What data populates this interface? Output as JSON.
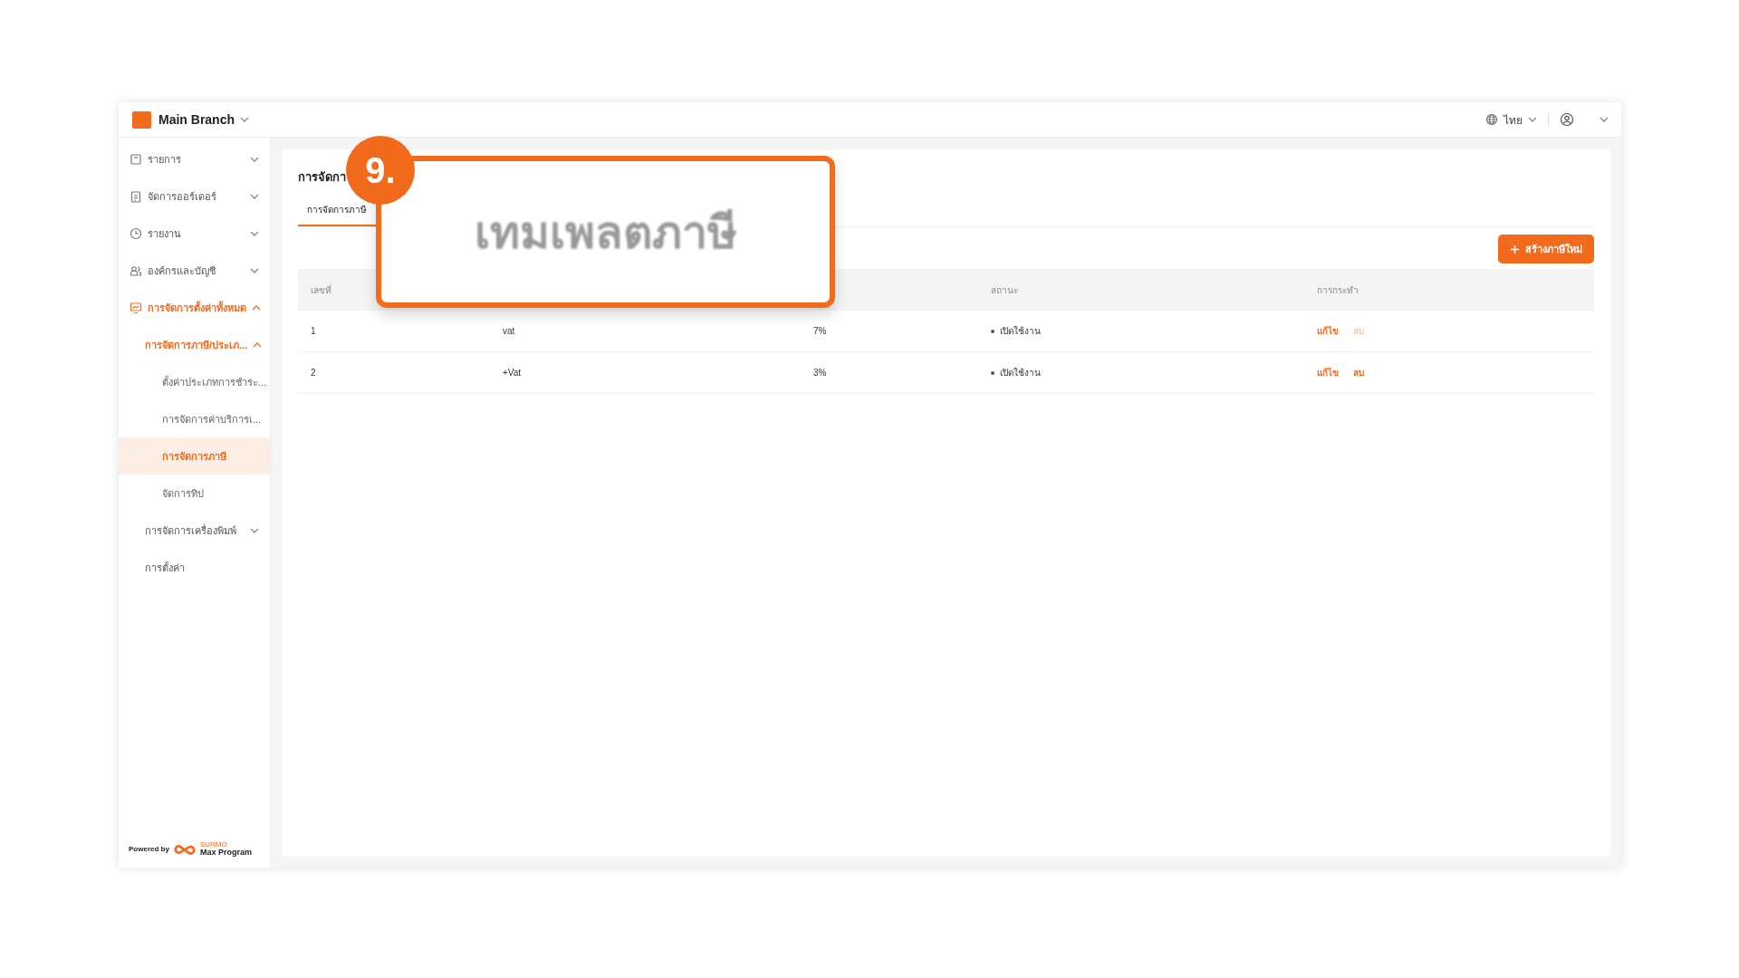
{
  "topbar": {
    "branch": "Main Branch",
    "language": "ไทย"
  },
  "sidebar": {
    "items": [
      {
        "label": "รายการ",
        "expanded": false,
        "selected": false
      },
      {
        "label": "จัดการออร์เดอร์",
        "expanded": false,
        "selected": false
      },
      {
        "label": "รายงาน",
        "expanded": false,
        "selected": false
      },
      {
        "label": "องค์กรและบัญชี",
        "expanded": false,
        "selected": false
      },
      {
        "label": "การจัดการตั้งค่าทั้งหมด",
        "expanded": true,
        "selected": true,
        "children": [
          {
            "label": "การจัดการภาษี/ประเภ...",
            "expanded": true,
            "selected": true,
            "children": [
              {
                "label": "ตั้งค่าประเภทการชำระ...",
                "selected": false
              },
              {
                "label": "การจัดการค่าบริการเ...",
                "selected": false
              },
              {
                "label": "การจัดการภาษี",
                "selected": true
              },
              {
                "label": "จัดการทิป",
                "selected": false
              }
            ]
          },
          {
            "label": "การจัดการเครื่องพิมพ์",
            "expanded": false,
            "selected": false
          },
          {
            "label": "การตั้งค่า",
            "selected": false
          }
        ]
      }
    ],
    "footer": {
      "powered_by": "Powered by",
      "brand_small": "SURMO",
      "brand": "Max Program"
    }
  },
  "page": {
    "title": "การจัดกา",
    "tabs": [
      {
        "label": "การจัดการภาษี",
        "selected": true
      }
    ],
    "create_button": "สร้างภาษีใหม่"
  },
  "table": {
    "columns": [
      "เลขที่",
      "",
      "",
      "สถานะ",
      "การกระทำ"
    ],
    "rows": [
      {
        "number": "1",
        "name": "vat",
        "rate": "7%",
        "status": "เปิดใช้งาน",
        "edit": "แก้ไข",
        "delete": "ลบ",
        "delete_disabled": true
      },
      {
        "number": "2",
        "name": "+Vat",
        "rate": "3%",
        "status": "เปิดใช้งาน",
        "edit": "แก้ไข",
        "delete": "ลบ",
        "delete_disabled": false
      }
    ]
  },
  "callout": {
    "step": "9.",
    "text": "เทมเพลตภาษี"
  }
}
